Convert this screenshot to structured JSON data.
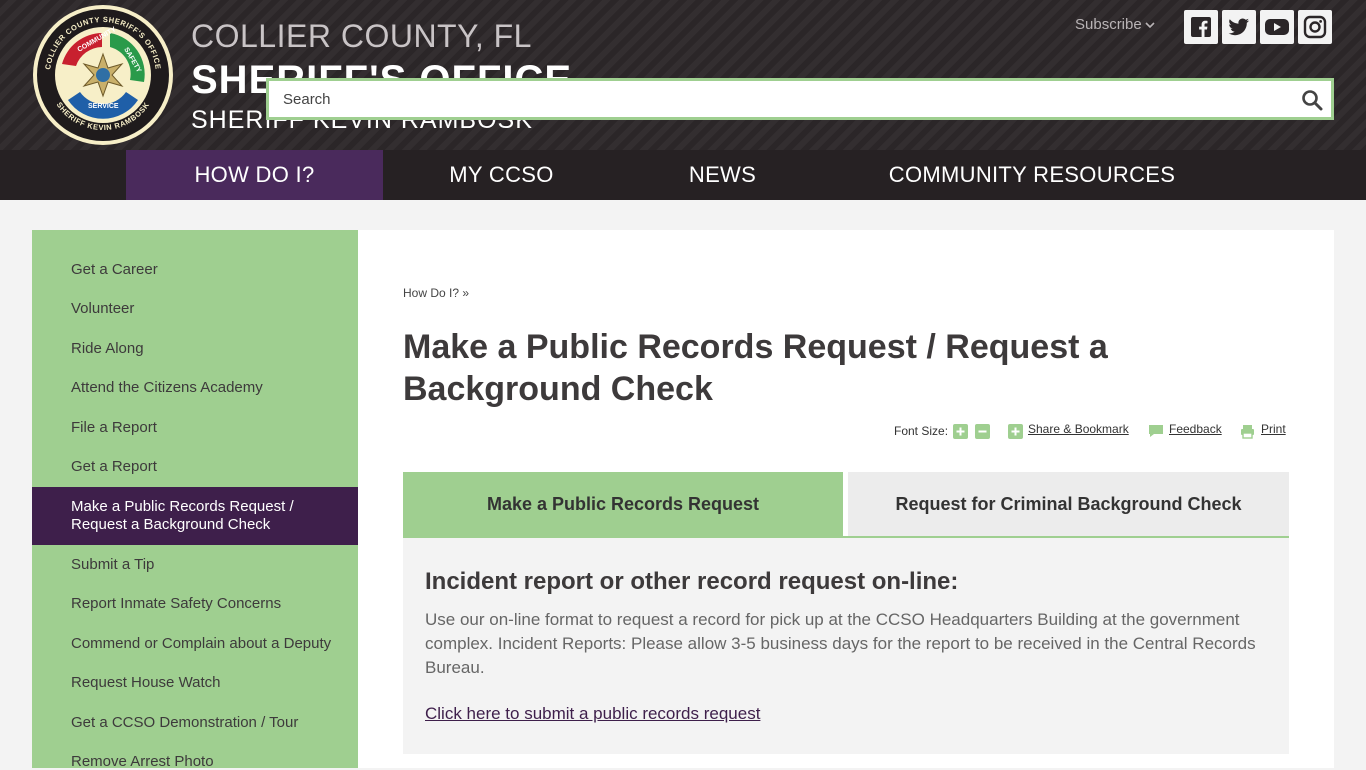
{
  "header": {
    "line1": "COLLIER COUNTY, FL",
    "line2": "SHERIFF'S OFFICE",
    "line3": "SHERIFF KEVIN RAMBOSK",
    "seal": {
      "ring_top": "COLLIER COUNTY SHERIFF'S OFFICE",
      "ring_bottom": "SHERIFF KEVIN RAMBOSK",
      "words": [
        "COMMUNITY",
        "SAFETY",
        "SERVICE"
      ]
    },
    "subscribe": "Subscribe",
    "search_placeholder": "Search",
    "social": [
      "facebook-icon",
      "twitter-icon",
      "youtube-icon",
      "instagram-icon"
    ]
  },
  "nav": {
    "items": [
      "HOW DO I?",
      "MY CCSO",
      "NEWS",
      "COMMUNITY RESOURCES"
    ],
    "active_index": 0
  },
  "sidebar": {
    "items": [
      "Get a Career",
      "Volunteer",
      "Ride Along",
      "Attend the Citizens Academy",
      "File a Report",
      "Get a Report",
      "Make a Public Records Request / Request a Background Check",
      "Submit a Tip",
      "Report Inmate Safety Concerns",
      "Commend or Complain about a Deputy",
      "Request House Watch",
      "Get a CCSO Demonstration / Tour",
      "Remove Arrest Photo"
    ],
    "active_index": 6
  },
  "main": {
    "breadcrumb": "How Do I? »",
    "title": "Make a Public Records Request / Request a Background Check",
    "tools": {
      "font_size": "Font Size:",
      "share": "Share & Bookmark",
      "feedback": "Feedback",
      "print": "Print"
    },
    "tabs": [
      "Make a Public Records Request",
      "Request for Criminal Background Check"
    ],
    "panel": {
      "heading": "Incident report or other record request on-line:",
      "body": "Use our on-line format to request a record for pick up at the CCSO Headquarters Building at the government complex. Incident Reports: Please allow 3-5 business days for the report to be received in the Central Records Bureau.",
      "link": "Click here to submit a public records request"
    }
  },
  "colors": {
    "header_bg": "#2b2628",
    "nav_bg": "#262123",
    "nav_active": "#4a2a5c",
    "accent_green": "#9fcf90",
    "sidebar_active": "#3e1f4b"
  }
}
